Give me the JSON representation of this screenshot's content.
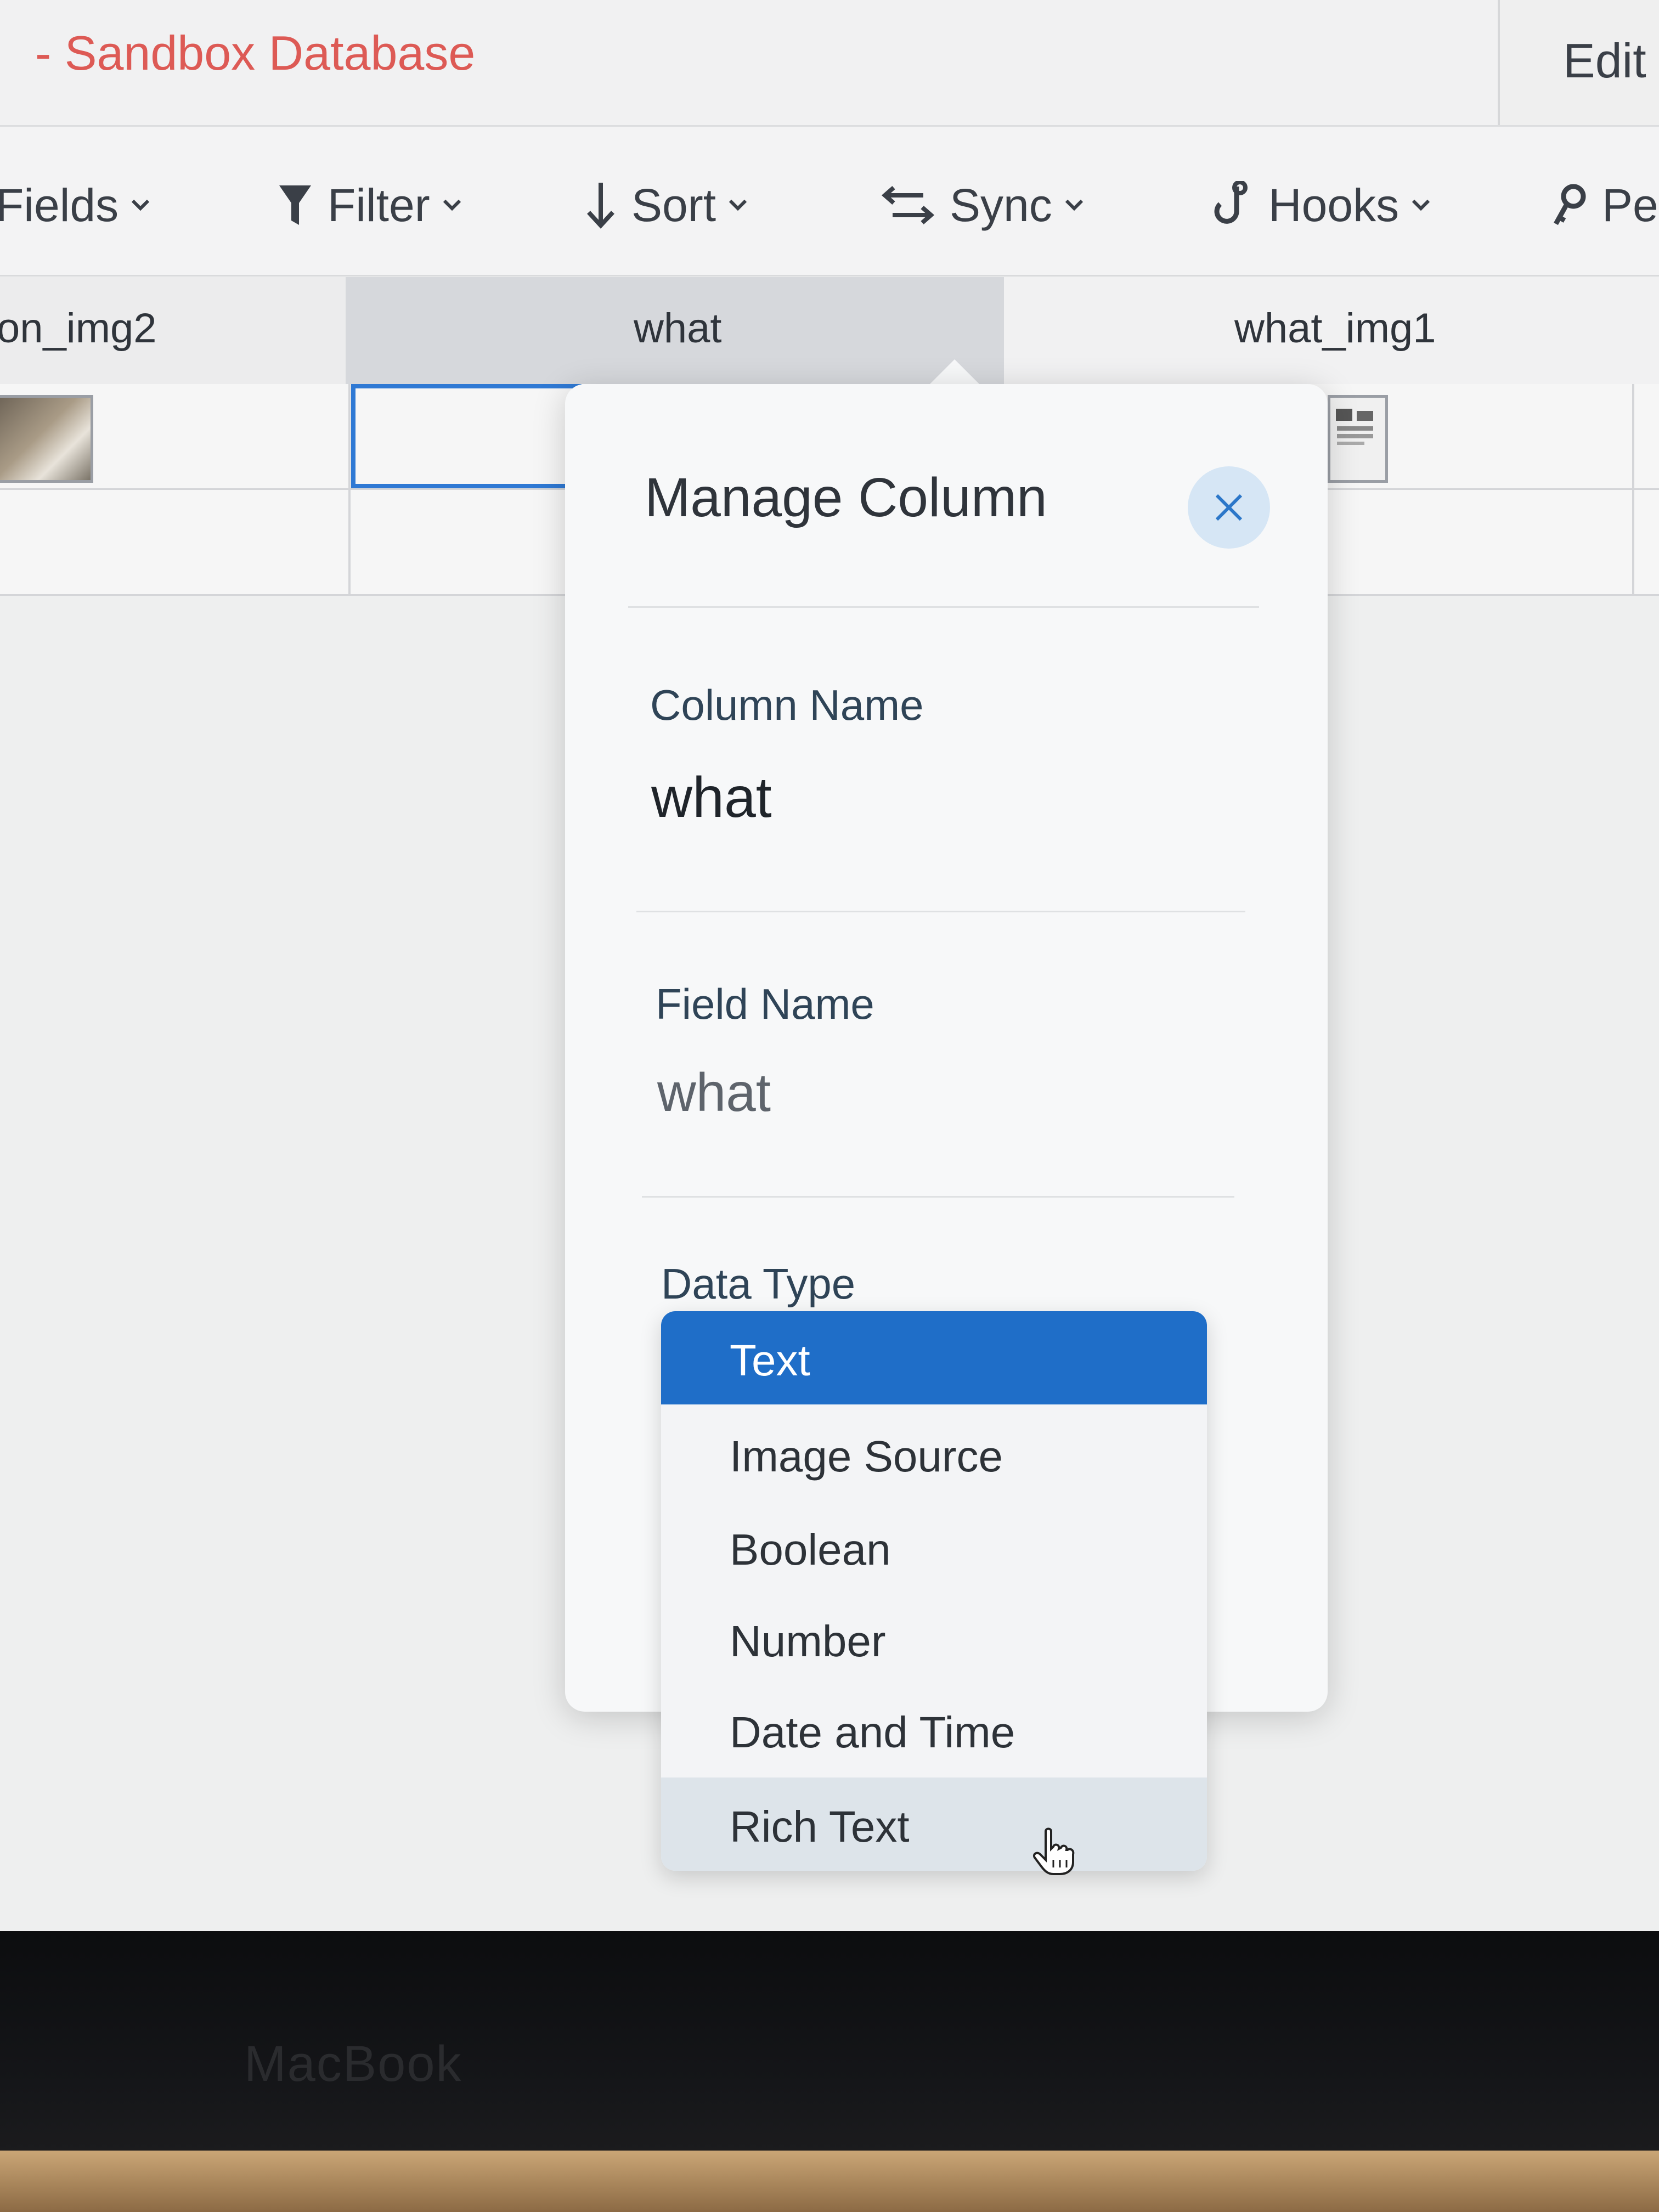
{
  "window": {
    "title": "- Sandbox Database",
    "edit_label": "Edit"
  },
  "toolbar": {
    "items": [
      {
        "label": "Fields",
        "icon": "fields-icon"
      },
      {
        "label": "Filter",
        "icon": "filter-icon"
      },
      {
        "label": "Sort",
        "icon": "sort-icon"
      },
      {
        "label": "Sync",
        "icon": "sync-icon"
      },
      {
        "label": "Hooks",
        "icon": "hooks-icon"
      },
      {
        "label": "Pe",
        "icon": "permissions-icon"
      }
    ]
  },
  "table": {
    "columns": [
      "on_img2",
      "what",
      "what_img1"
    ]
  },
  "manage_column": {
    "title": "Manage Column",
    "column_name_label": "Column Name",
    "column_name_value": "what",
    "field_name_label": "Field Name",
    "field_name_value": "what",
    "data_type_label": "Data Type",
    "data_type_options": [
      "Text",
      "Image Source",
      "Boolean",
      "Number",
      "Date and Time",
      "Rich Text"
    ],
    "data_type_selected": "Text",
    "data_type_hovered": "Rich Text"
  },
  "device": {
    "brand": "MacBook"
  },
  "colors": {
    "title_red": "#dd5a55",
    "selected_blue": "#1f6ec8",
    "close_button_bg": "#d6e6f5"
  }
}
